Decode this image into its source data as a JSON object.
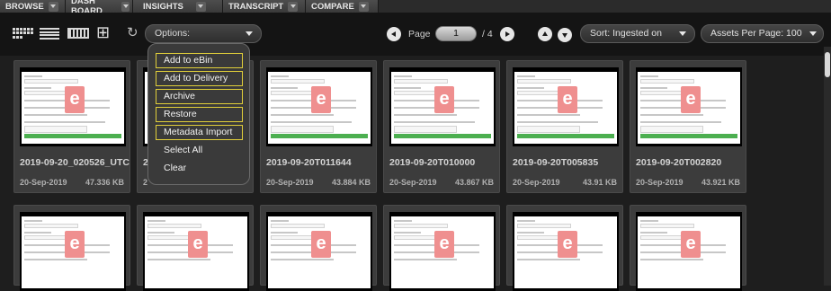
{
  "nav": {
    "tabs": [
      {
        "label": "BROWSE"
      },
      {
        "label": "DASH BOARD"
      },
      {
        "label": "INSIGHTS"
      },
      {
        "label": "TRANSCRIPT"
      },
      {
        "label": "COMPARE"
      }
    ]
  },
  "toolbar": {
    "view_icons": [
      "grid-view-icon",
      "list-view-icon",
      "filmstrip-view-icon",
      "add-asset-icon",
      "refresh-icon"
    ],
    "options_label": "Options:",
    "page_label": "Page",
    "page_value": "1",
    "page_total": "/ 4",
    "sort_label": "Sort: Ingested on",
    "per_page_label": "Assets Per Page: 100"
  },
  "options_menu": {
    "items": [
      {
        "label": "Add to eBin",
        "highlighted": true
      },
      {
        "label": "Add to Delivery",
        "highlighted": true
      },
      {
        "label": "Archive",
        "highlighted": true
      },
      {
        "label": "Restore",
        "highlighted": true
      },
      {
        "label": "Metadata Import",
        "highlighted": true
      },
      {
        "label": "Select All",
        "highlighted": false
      },
      {
        "label": "Clear",
        "highlighted": false
      }
    ]
  },
  "assets": {
    "row1": [
      {
        "title": "2019-09-20_020526_UTC",
        "date": "20-Sep-2019",
        "size": "47.336 KB"
      },
      {
        "title": "2",
        "date": "2",
        "size": ""
      },
      {
        "title": "2019-09-20T011644",
        "date": "20-Sep-2019",
        "size": "43.884 KB"
      },
      {
        "title": "2019-09-20T010000",
        "date": "20-Sep-2019",
        "size": "43.867 KB"
      },
      {
        "title": "2019-09-20T005835",
        "date": "20-Sep-2019",
        "size": "43.91 KB"
      },
      {
        "title": "2019-09-20T002820",
        "date": "20-Sep-2019",
        "size": "43.921 KB"
      }
    ],
    "row2_count": 6
  },
  "colors": {
    "background": "#1e1e1e",
    "toolbar": "#141414",
    "card": "#3c3c3c",
    "menu_highlight": "#e1cf3a",
    "thumb_accent": "#4caf50",
    "logo": "#ef8f8f"
  }
}
